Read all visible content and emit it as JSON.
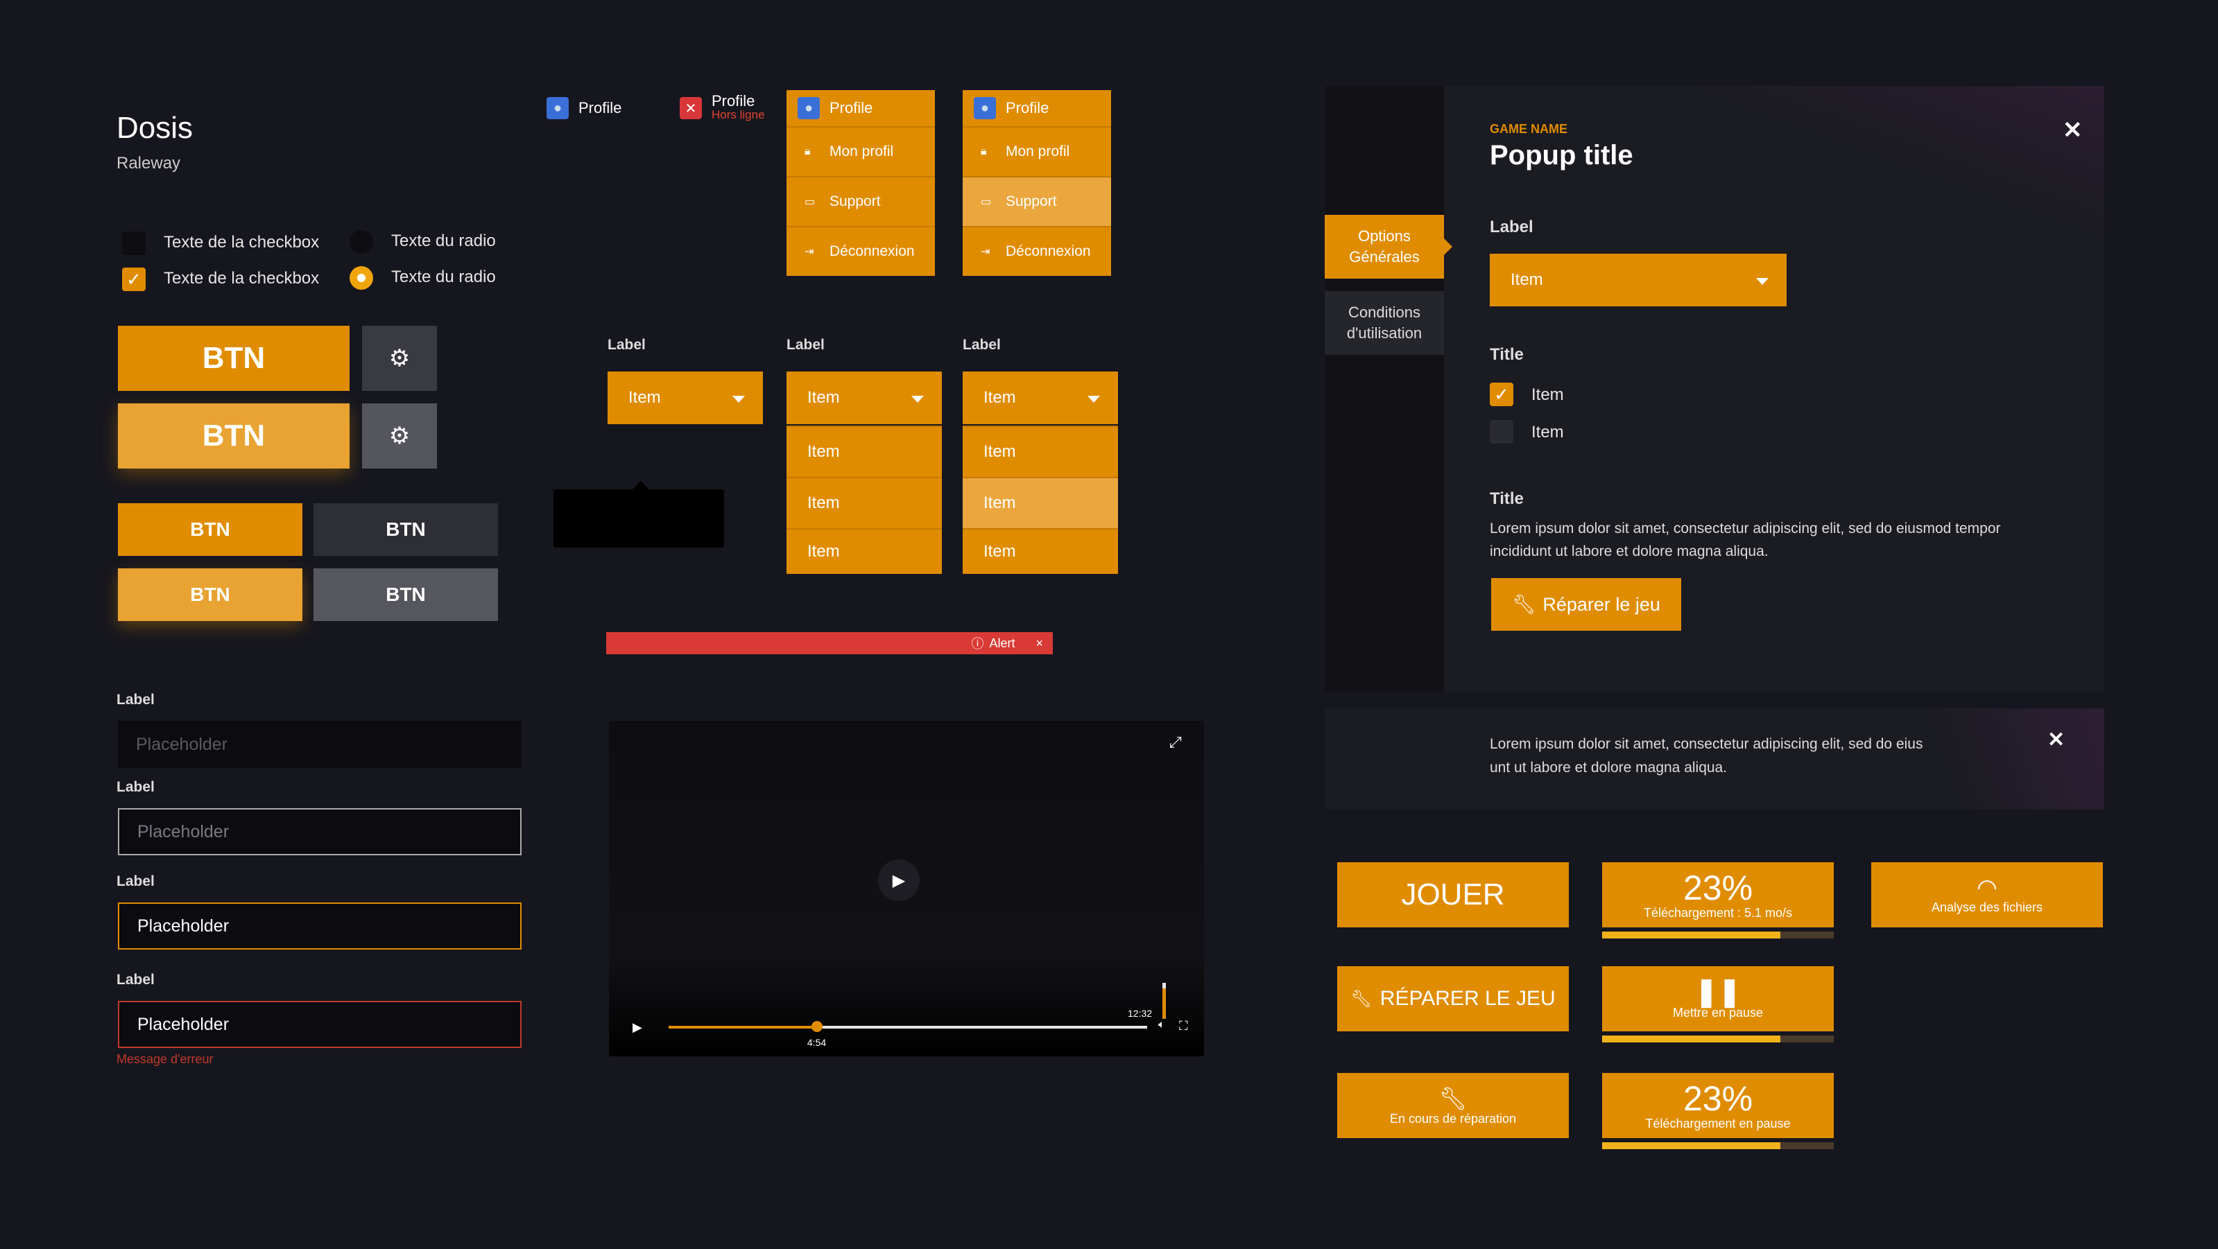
{
  "typography": {
    "heading_font": "Dosis",
    "body_font": "Raleway"
  },
  "checkboxes": [
    {
      "label": "Texte de la checkbox",
      "checked": false
    },
    {
      "label": "Texte de la checkbox",
      "checked": true
    }
  ],
  "radios": [
    {
      "label": "Texte du radio",
      "checked": false
    },
    {
      "label": "Texte du radio",
      "checked": true
    }
  ],
  "buttons": {
    "big": "BTN",
    "small": "BTN",
    "gear_icon": "gear-icon"
  },
  "inputs": [
    {
      "label": "Label",
      "placeholder": "Placeholder",
      "state": "default"
    },
    {
      "label": "Label",
      "placeholder": "Placeholder",
      "state": "hover"
    },
    {
      "label": "Label",
      "placeholder": "Placeholder",
      "state": "focus"
    },
    {
      "label": "Label",
      "placeholder": "Placeholder",
      "state": "error",
      "error": "Message d'erreur"
    }
  ],
  "profile": {
    "label": "Profile",
    "offline_label": "Hors ligne",
    "menu": [
      "Mon profil",
      "Support",
      "Déconnexion"
    ]
  },
  "dropdowns": {
    "label": "Label",
    "selected": "Item",
    "items": [
      "Item",
      "Item",
      "Item"
    ]
  },
  "alert": {
    "text": "Alert",
    "close": "×"
  },
  "video": {
    "current_time": "4:54",
    "duration": "12:32",
    "progress": 0.31,
    "volume": 0.85
  },
  "popup": {
    "game_name": "GAME NAME",
    "title": "Popup title",
    "tabs": [
      {
        "label": "Options Générales",
        "active": true
      },
      {
        "label": "Conditions d'utilisation",
        "active": false
      }
    ],
    "select_label": "Label",
    "select_value": "Item",
    "check_title": "Title",
    "check_items": [
      {
        "label": "Item",
        "checked": true
      },
      {
        "label": "Item",
        "checked": false
      }
    ],
    "text_title": "Title",
    "body": "Lorem ipsum dolor sit amet, consectetur adipiscing elit, sed do eiusmod tempor incididunt ut labore et dolore magna aliqua.",
    "repair_button": "Réparer le jeu"
  },
  "notification": {
    "line1": "Lorem ipsum dolor sit amet, consectetur adipiscing elit, sed do eius",
    "line2": "unt ut labore et dolore magna aliqua."
  },
  "launcher": {
    "play": "JOUER",
    "repair": "RÉPARER LE JEU",
    "repairing": "En cours de réparation",
    "download_pct": "23%",
    "download_sub": "Téléchargement : 5.1 mo/s",
    "download_progress": 0.77,
    "pause_sub": "Mettre en pause",
    "pause_progress": 0.77,
    "paused_pct": "23%",
    "paused_sub": "Téléchargement en pause",
    "paused_progress": 0.77,
    "analyse": "Analyse des fichiers"
  },
  "colors": {
    "accent": "#e08c00",
    "accent_light": "#e8a333",
    "background": "#16161e",
    "alert": "#d93a35",
    "error": "#c0392b"
  }
}
